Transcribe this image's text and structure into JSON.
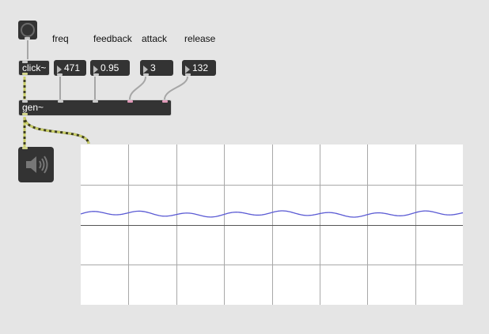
{
  "labels": {
    "freq": "freq",
    "feedback": "feedback",
    "attack": "attack",
    "release": "release"
  },
  "objects": {
    "click": "click~",
    "gen": "gen~"
  },
  "numbers": {
    "freq": "471",
    "feedback": "0.95",
    "attack": "3",
    "release": "132"
  },
  "icons": {
    "button": "bang-button-icon",
    "speaker": "speaker-icon"
  },
  "scope": {
    "grid_columns": 8,
    "grid_rows": 4,
    "colors": {
      "signal": "#5b5bd4",
      "grid": "#a8a8a8",
      "background": "#ffffff"
    }
  }
}
